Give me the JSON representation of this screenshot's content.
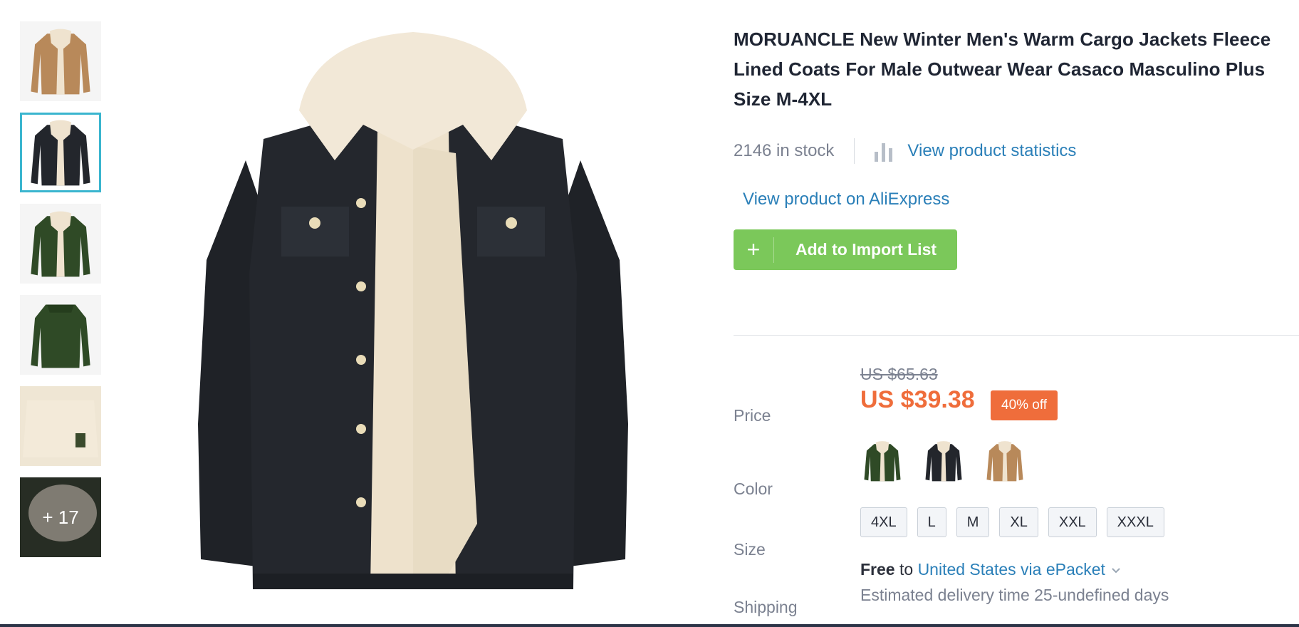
{
  "product": {
    "title": "MORUANCLE New Winter Men's Warm Cargo Jackets Fleece Lined Coats For Male Outwear Wear Casaco Masculino Plus Size M-4XL",
    "stock_text": "2146 in stock",
    "stats_link": "View product statistics",
    "aliexpress_link": "View product on AliExpress",
    "import_button": {
      "icon": "plus-icon",
      "label": "Add to Import List"
    }
  },
  "gallery": {
    "thumbnail_colors": [
      "tan",
      "black",
      "green",
      "green",
      "cream",
      "black"
    ],
    "active_index": 1,
    "more_label": "+ 17"
  },
  "price": {
    "label": "Price",
    "original": "US $65.63",
    "current": "US $39.38",
    "discount": "40% off"
  },
  "color": {
    "label": "Color",
    "options": [
      "green",
      "black",
      "tan"
    ]
  },
  "size": {
    "label": "Size",
    "options": [
      "4XL",
      "L",
      "M",
      "XL",
      "XXL",
      "XXXL"
    ]
  },
  "shipping": {
    "label": "Shipping",
    "cost": "Free",
    "connector": "to",
    "destination": "United States via ePacket",
    "delivery": "Estimated delivery time 25-undefined days"
  },
  "colors": {
    "accent_link": "#2a7fb8",
    "button_green": "#7bc85a",
    "price_orange": "#ef6d3b",
    "active_thumb": "#3ab5cf"
  }
}
